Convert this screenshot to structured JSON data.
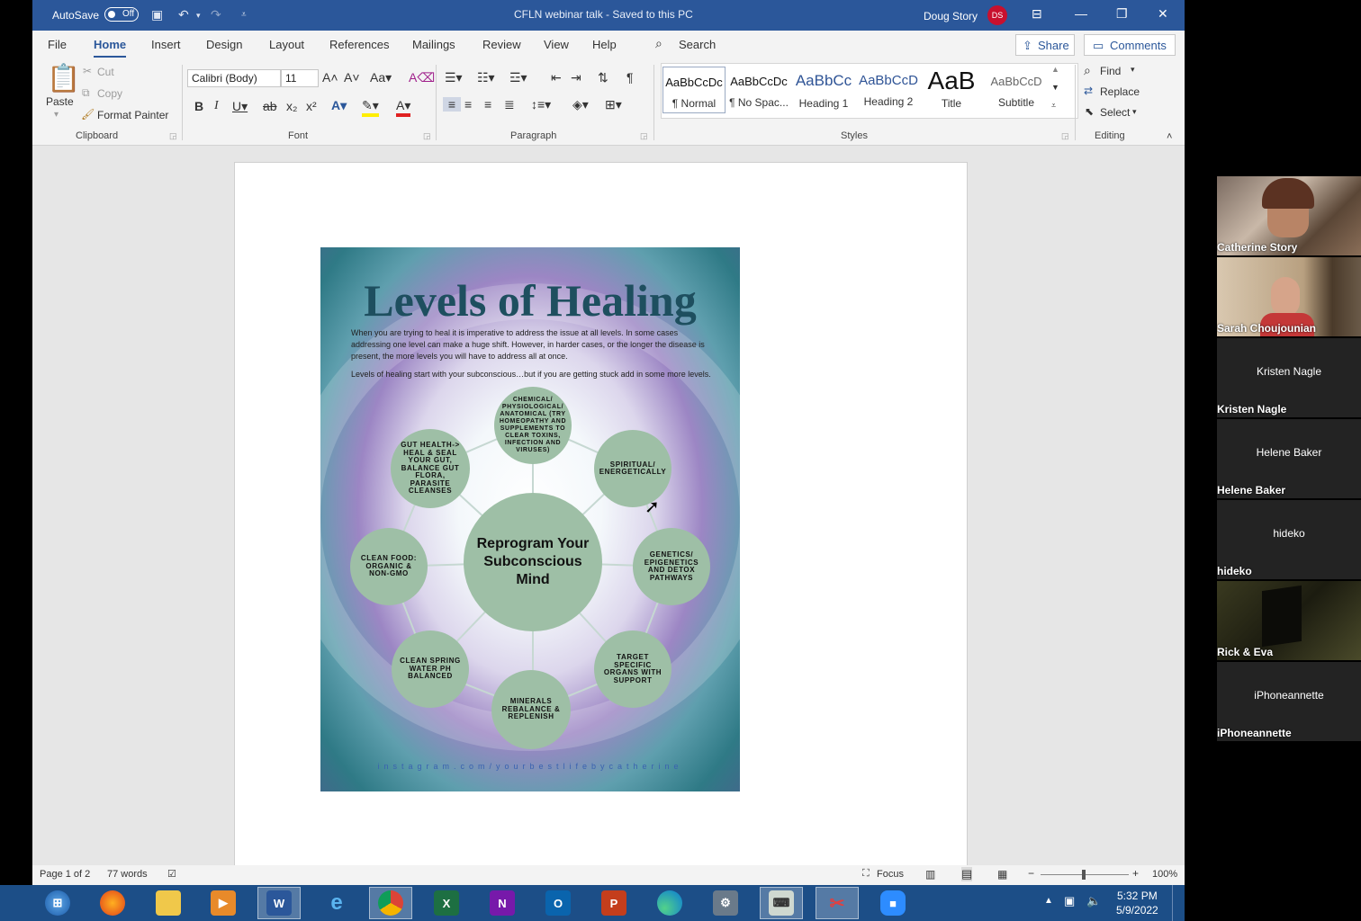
{
  "titlebar": {
    "autosave_label": "AutoSave",
    "autosave_state": "Off",
    "doc_title": "CFLN webinar talk  -  Saved to this PC",
    "user_name": "Doug Story",
    "user_initials": "DS"
  },
  "menu": {
    "tabs": [
      "File",
      "Home",
      "Insert",
      "Design",
      "Layout",
      "References",
      "Mailings",
      "Review",
      "View",
      "Help"
    ],
    "active_tab": "Home",
    "search_label": "Search",
    "share_label": "Share",
    "comments_label": "Comments"
  },
  "ribbon": {
    "clipboard": {
      "paste_label": "Paste",
      "cut_label": "Cut",
      "copy_label": "Copy",
      "format_painter_label": "Format Painter",
      "group_label": "Clipboard"
    },
    "font": {
      "font_name": "Calibri (Body)",
      "font_size": "11",
      "group_label": "Font"
    },
    "paragraph": {
      "group_label": "Paragraph"
    },
    "styles": {
      "items": [
        {
          "preview": "AaBbCcDc",
          "label": "¶ Normal"
        },
        {
          "preview": "AaBbCcDc",
          "label": "¶ No Spac..."
        },
        {
          "preview": "AaBbCc",
          "label": "Heading 1"
        },
        {
          "preview": "AaBbCcD",
          "label": "Heading 2"
        },
        {
          "preview": "AaB",
          "label": "Title"
        },
        {
          "preview": "AaBbCcD",
          "label": "Subtitle"
        }
      ],
      "group_label": "Styles"
    },
    "editing": {
      "find_label": "Find",
      "replace_label": "Replace",
      "select_label": "Select",
      "group_label": "Editing"
    }
  },
  "poster": {
    "title": "Levels of Healing",
    "intro_1": "When you are trying to heal it is imperative to address the issue at all levels.  In some cases addressing one level can make a huge shift.   However, in harder cases, or the longer the disease is present, the more levels you will have to address all at once.",
    "intro_2": "Levels of healing start with your subconscious…but if you are getting stuck add in some more levels.",
    "center": "Reprogram Your Subconscious Mind",
    "nodes": [
      "CHEMICAL/ PHYSIOLOGICAL/ ANATOMICAL (TRY HOMEOPATHY AND SUPPLEMENTS TO CLEAR TOXINS, INFECTION AND VIRUSES)",
      "SPIRITUAL/ ENERGETICALLY",
      "GENETICS/ EPIGENETICS AND DETOX PATHWAYS",
      "TARGET SPECIFIC ORGANS WITH SUPPORT",
      "MINERALS REBALANCE & REPLENISH",
      "CLEAN SPRING WATER PH BALANCED",
      "CLEAN FOOD: ORGANIC & NON-GMO",
      "GUT HEALTH-> HEAL & SEAL YOUR GUT, BALANCE GUT FLORA, PARASITE CLEANSES"
    ],
    "footer": "instagram.com/yourbestlifebycatherine"
  },
  "statusbar": {
    "page": "Page 1 of 2",
    "words": "77 words",
    "focus_label": "Focus",
    "zoom": "100%"
  },
  "taskbar": {
    "apps": [
      "Start",
      "Firefox",
      "File Explorer",
      "Media Player",
      "Word",
      "Internet Explorer",
      "Chrome",
      "Excel",
      "OneNote",
      "Outlook",
      "PowerPoint",
      "Edge",
      "Remote Desktop",
      "Keyboard",
      "Snipping Tool",
      "Zoom"
    ],
    "time": "5:32 PM",
    "date": "5/9/2022"
  },
  "participants": [
    {
      "name": "Catherine Story",
      "video": true
    },
    {
      "name": "Sarah Choujounian",
      "video": true
    },
    {
      "name": "Kristen Nagle",
      "video": false
    },
    {
      "name": "Helene Baker",
      "video": false
    },
    {
      "name": "hideko",
      "video": false
    },
    {
      "name": "Rick & Eva",
      "video": true
    },
    {
      "name": "iPhoneannette",
      "video": false
    }
  ],
  "colors": {
    "word_blue": "#2b579a",
    "node_green": "#9ebfa6",
    "avatar_red": "#c8102e"
  }
}
